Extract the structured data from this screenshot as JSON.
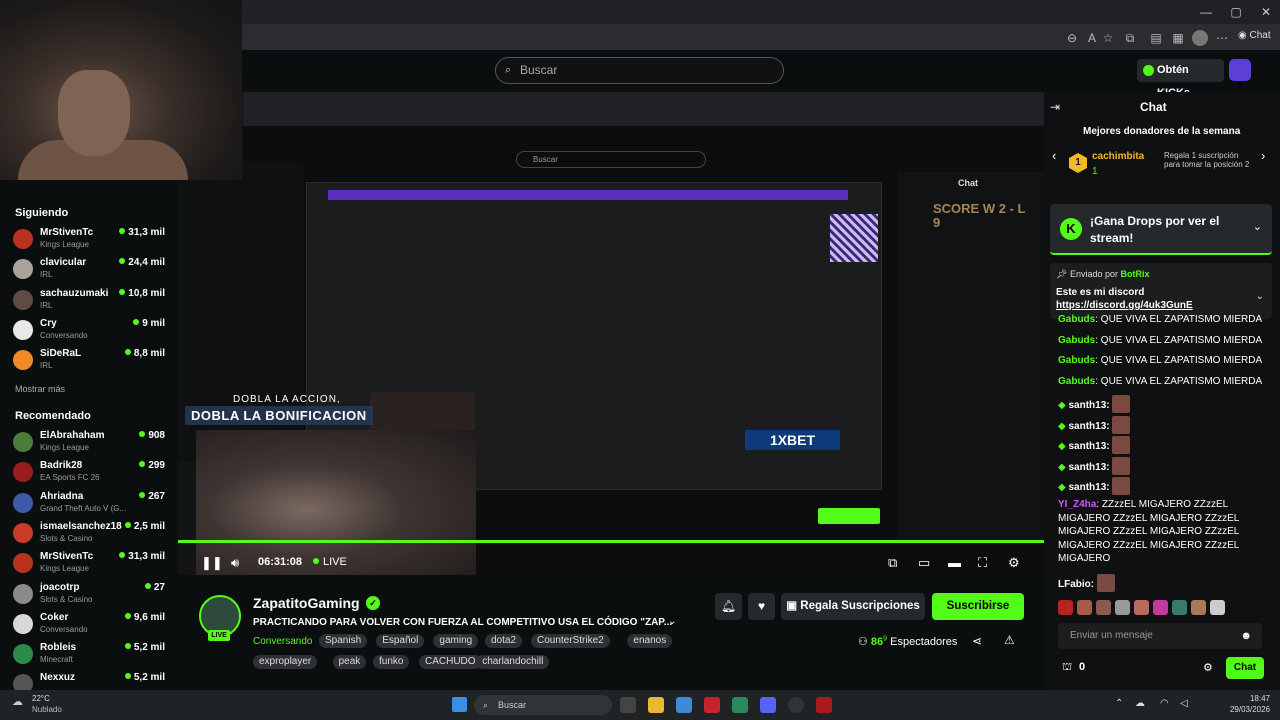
{
  "webcam": {
    "description_icon": "webcam-icon"
  },
  "browser": {
    "window_buttons": [
      "—",
      "▢",
      "✕"
    ]
  },
  "header": {
    "search_placeholder": "Buscar",
    "kicks_button": "Obtén KICKs"
  },
  "sidebar": {
    "following_title": "Siguiendo",
    "following": [
      {
        "name": "MrStivenTc",
        "category": "Kings League",
        "viewers": "31,3 mil",
        "color": "#b8331f"
      },
      {
        "name": "clavicular",
        "category": "IRL",
        "viewers": "24,4 mil",
        "color": "#a8a29a"
      },
      {
        "name": "sachauzumaki",
        "category": "IRL",
        "viewers": "10,8 mil",
        "color": "#5d4c44"
      },
      {
        "name": "Cry",
        "category": "Conversando",
        "viewers": "9 mil",
        "color": "#e8e8e8"
      },
      {
        "name": "SiDeRaL",
        "category": "IRL",
        "viewers": "8,8 mil",
        "color": "#f08a24"
      }
    ],
    "show_more": "Mostrar más",
    "recommended_title": "Recomendado",
    "recommended": [
      {
        "name": "ElAbrahaham",
        "category": "Kings League",
        "viewers": "908",
        "color": "#4a7c3c"
      },
      {
        "name": "Badrik28",
        "category": "EA Sports FC 26",
        "viewers": "299",
        "color": "#9a1c1c"
      },
      {
        "name": "Ahriadna",
        "category": "Grand Theft Auto V (G...",
        "viewers": "267",
        "color": "#3c5aa8"
      },
      {
        "name": "ismaelsanchez18",
        "category": "Slots & Casino",
        "viewers": "2,5 mil",
        "color": "#c83a2a"
      },
      {
        "name": "MrStivenTc",
        "category": "Kings League",
        "viewers": "31,3 mil",
        "color": "#b8331f"
      },
      {
        "name": "joacotrp",
        "category": "Slots & Casino",
        "viewers": "27",
        "color": "#8a8a8a"
      },
      {
        "name": "Coker",
        "category": "Conversando",
        "viewers": "9,6 mil",
        "color": "#d8d8d8"
      },
      {
        "name": "Robleis",
        "category": "Minecraft",
        "viewers": "5,2 mil",
        "color": "#2e8a4a"
      },
      {
        "name": "Nexxuz",
        "category": "",
        "viewers": "5,2 mil",
        "color": "#555555"
      }
    ]
  },
  "video": {
    "promo_line1": "DOBLA LA ACCION,",
    "promo_line2": "DOBLA LA BONIFICACION",
    "sponsor": "1XBET",
    "inner_title_chat": "Chat",
    "inner_search": "Buscar",
    "overlay_text": "SCORE W 2 - L 9"
  },
  "player": {
    "time": "06:31:08",
    "live_label": "LIVE",
    "progress_fraction": 1.0
  },
  "stream": {
    "name": "ZapatitoGaming",
    "live_badge": "LIVE",
    "title": "PRACTICANDO PARA VOLVER CON FUERZA AL COMPETITIVO   USA EL CÓDIGO \"ZAP...",
    "category": "Conversando",
    "tags_row1": [
      "Spanish",
      "Español",
      "gaming",
      "dota2",
      "CounterStrike2",
      "enanos"
    ],
    "tags_row2": [
      "exproplayer",
      "peak",
      "funko",
      "CACHUDO",
      "charlandochill"
    ],
    "gift_button": "Regala Suscripciones",
    "subscribe_button": "Suscribirse",
    "viewers_number": "86",
    "viewers_sup": "9",
    "viewers_label": "Espectadores"
  },
  "chat": {
    "title": "Chat",
    "donors_title": "Mejores donadores de la semana",
    "donor_rank": "1",
    "donor_name": "cachimbita",
    "donor_count": "1",
    "donor_cta": "Regala 1 suscripción para tomar la posición 2",
    "drops_text": "¡Gana Drops por ver el stream!",
    "pinned_by_prefix": "Enviado por",
    "pinned_by_user": "BotRix",
    "pinned_line1": "Este es mi discord",
    "pinned_line2": "https://discord.gg/4uk3GunE",
    "messages": [
      {
        "user": "Gabuds",
        "text": ": QUE VIVA EL ZAPATISMO MIERDA",
        "color": "#53fc18"
      },
      {
        "user": "Gabuds",
        "text": ": QUE VIVA EL ZAPATISMO MIERDA",
        "color": "#53fc18"
      },
      {
        "user": "Gabuds",
        "text": ": QUE VIVA EL ZAPATISMO MIERDA",
        "color": "#53fc18"
      },
      {
        "user": "Gabuds",
        "text": ": QUE VIVA EL ZAPATISMO MIERDA",
        "color": "#53fc18"
      }
    ],
    "santh_user": "santh13:",
    "yi_user": "YI_Z4ha",
    "yi_text": ": ZZzzEL MIGAJERO ZZzzEL MIGAJERO ZZzzEL MIGAJERO ZZzzEL MIGAJERO ZZzzEL MIGAJERO ZZzzEL MIGAJERO ZZzzEL MIGAJERO ZZzzEL MIGAJERO",
    "lfabio_user": "LFabio:",
    "input_placeholder": "Enviar un mensaje",
    "kicks_count": "0",
    "send_button": "Chat"
  },
  "taskbar": {
    "weather_temp": "22°C",
    "weather_desc": "Nublado",
    "search_placeholder": "Buscar",
    "time": "18:47",
    "date": "29/03/2026"
  }
}
